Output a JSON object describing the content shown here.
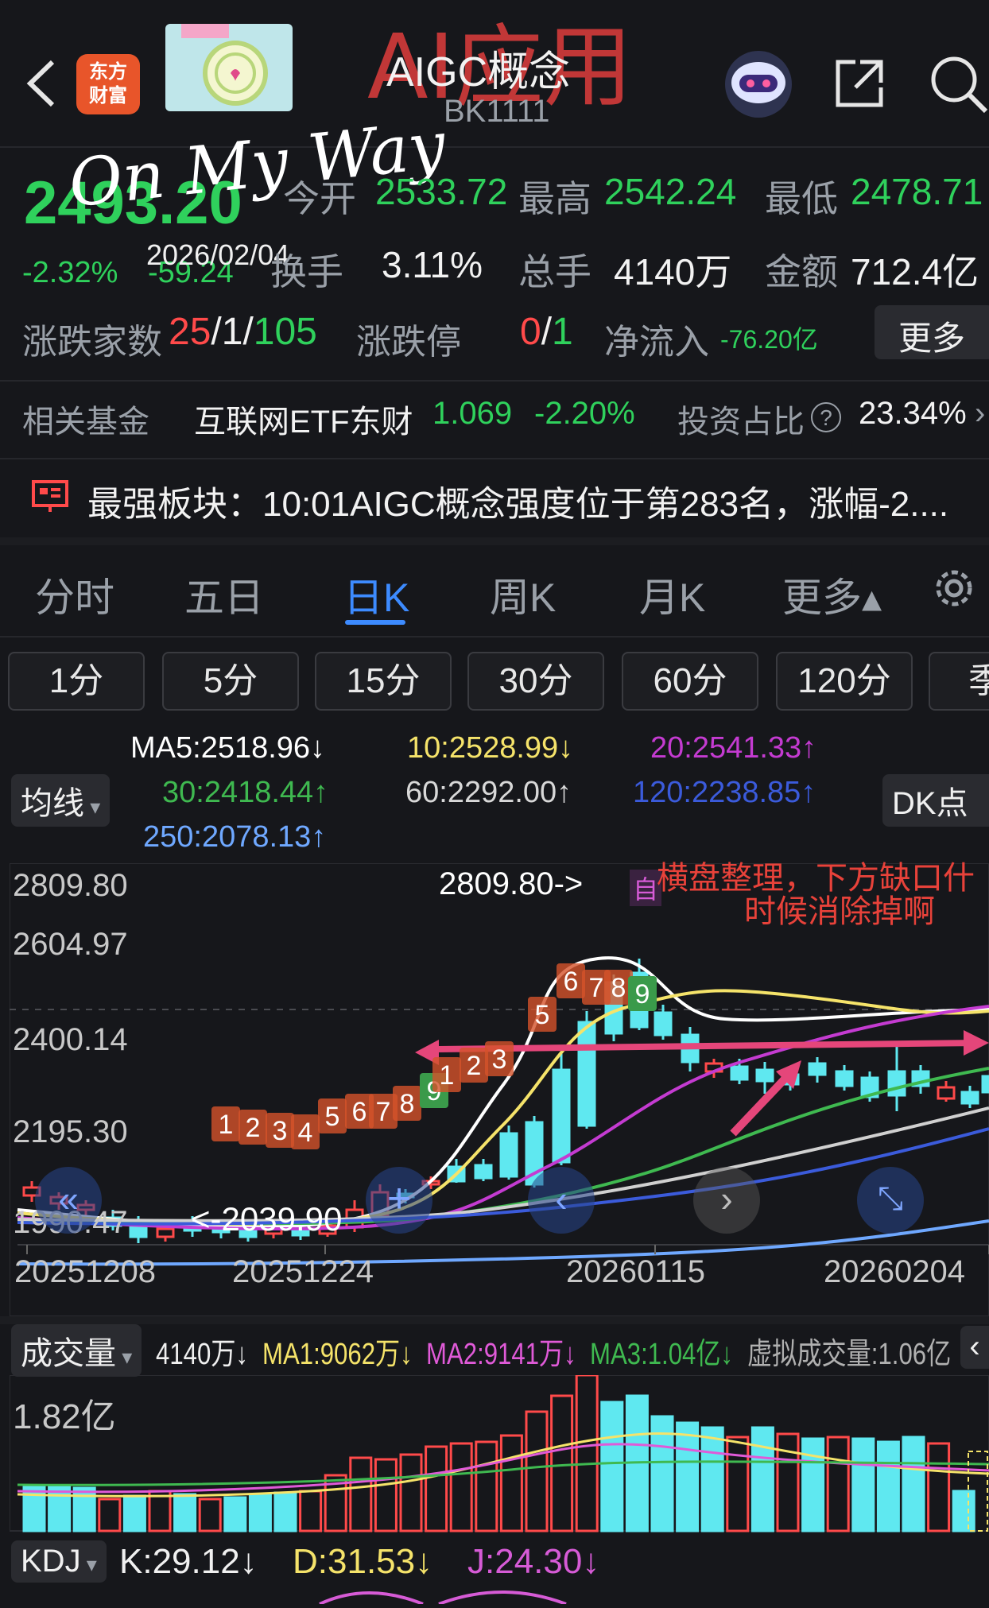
{
  "header": {
    "title": "AIGC概念",
    "code": "BK1111",
    "brand_badge": "东方\n财富",
    "overlay_handwriting": "AI应用",
    "overlay_signature": "On My Way",
    "overlay_date": "2026/02/04"
  },
  "quote": {
    "price": "2493.20",
    "change_pct": "-2.32%",
    "change": "-59.24",
    "open_label": "今开",
    "open": "2533.72",
    "high_label": "最高",
    "high": "2542.24",
    "low_label": "最低",
    "low": "2478.71",
    "turnover_label": "换手",
    "turnover": "3.11%",
    "volume_label": "总手",
    "volume": "4140万",
    "amount_label": "金额",
    "amount": "712.4亿",
    "breadth_label": "涨跌家数",
    "breadth_up": "25",
    "breadth_flat": "1",
    "breadth_down": "105",
    "limit_label": "涨跌停",
    "limit_up": "0",
    "limit_down": "1",
    "netflow_label": "净流入",
    "netflow": "-76.20亿",
    "more": "更多"
  },
  "fund": {
    "label": "相关基金",
    "name": "互联网ETF东财",
    "price": "1.069",
    "change": "-2.20%",
    "ratio_label": "投资占比",
    "ratio": "23.34%"
  },
  "notice": "最强板块：10:01AIGC概念强度位于第283名，涨幅-2....",
  "tabs": [
    "分时",
    "五日",
    "日K",
    "周K",
    "月K",
    "更多▴"
  ],
  "active_tab": "日K",
  "periods": [
    "1分",
    "5分",
    "15分",
    "30分",
    "60分",
    "120分",
    "季"
  ],
  "ma": {
    "selector": "均线",
    "ma5": "MA5:2518.96↓",
    "ma10": "10:2528.99↓",
    "ma20": "20:2541.33↑",
    "ma30": "30:2418.44↑",
    "ma60": "60:2292.00↑",
    "ma120": "120:2238.85↑",
    "ma250": "250:2078.13↑",
    "dk": "DK点"
  },
  "chart": {
    "y_ticks": [
      "2809.80",
      "2604.97",
      "2400.14",
      "2195.30",
      "1990.47"
    ],
    "x_ticks": [
      "20251208",
      "20251224",
      "20260115",
      "20260204"
    ],
    "max_label": "2809.80->",
    "min_label": "<-2039.90",
    "self_tag": "自",
    "annotation_line1": "横盘整理，下方缺口什",
    "annotation_line2": "时候消除掉啊",
    "seq_numbers": [
      "1",
      "2",
      "3",
      "4",
      "5",
      "6",
      "7",
      "8",
      "9",
      "1",
      "2",
      "3",
      "5",
      "6",
      "7",
      "8",
      "9"
    ]
  },
  "volume": {
    "selector": "成交量",
    "value": "4140万↓",
    "ma1": "MA1:9062万↓",
    "ma2": "MA2:9141万↓",
    "ma3": "MA3:1.04亿↓",
    "virtual": "虚拟成交量:1.06亿",
    "y_max": "1.82亿"
  },
  "kdj": {
    "selector": "KDJ",
    "k": "K:29.12↓",
    "d": "D:31.53↓",
    "j": "J:24.30↓"
  },
  "colors": {
    "up": "#ff4a4a",
    "down": "#2fd15c",
    "accent": "#3d8bff",
    "ma5": "#ffffff",
    "ma10": "#f5e36a",
    "ma20": "#c43bd1",
    "ma30": "#3fb950",
    "ma60": "#d0d0d0",
    "ma120": "#3b5bdb",
    "ma250": "#6fa8ff"
  }
}
